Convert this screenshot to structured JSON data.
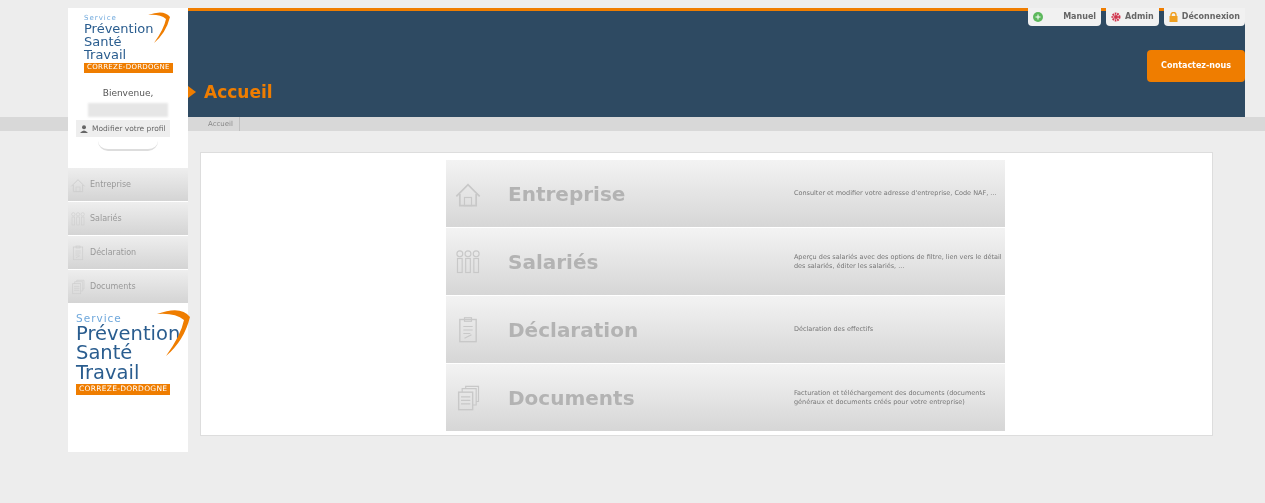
{
  "logo": {
    "service": "Service",
    "line1": "Prévention",
    "line2": "Santé",
    "line3": "Travail",
    "region": "CORREZE-DORDOGNE"
  },
  "welcome": "Bienvenue,",
  "profile_button": "Modifier votre profil",
  "top_links": [
    {
      "label": "Manuel",
      "kind": "help"
    },
    {
      "label": "Admin",
      "kind": "gear"
    },
    {
      "label": "Déconnexion",
      "kind": "lock"
    }
  ],
  "contact_button": "Contactez-nous",
  "page_title": "Accueil",
  "breadcrumb": [
    "Accueil"
  ],
  "sidebar": {
    "items": [
      {
        "label": "Entreprise",
        "kind": "house"
      },
      {
        "label": "Salariés",
        "kind": "people"
      },
      {
        "label": "Déclaration",
        "kind": "clipboard"
      },
      {
        "label": "Documents",
        "kind": "docs"
      }
    ]
  },
  "tiles": [
    {
      "title": "Entreprise",
      "kind": "house",
      "description": "Consulter et modifier votre adresse d'entreprise, Code NAF, ..."
    },
    {
      "title": "Salariés",
      "kind": "people",
      "description": "Aperçu des salariés avec des options de filtre, lien vers le détail des salariés, éditer les salariés, ..."
    },
    {
      "title": "Déclaration",
      "kind": "clipboard",
      "description": "Déclaration des effectifs"
    },
    {
      "title": "Documents",
      "kind": "docs",
      "description": "Facturation et téléchargement des documents (documents généraux et documents créés pour votre entreprise)"
    }
  ],
  "footer_logo": {
    "service": "Service",
    "line1": "Prévention",
    "line2": "Santé",
    "line3": "Travail",
    "region": "CORREZE-DORDOGNE"
  }
}
